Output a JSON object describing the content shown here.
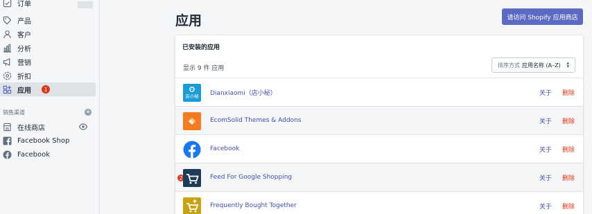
{
  "sidebar": {
    "items": [
      {
        "label": "订单",
        "icon": "orders-icon"
      },
      {
        "label": "产品",
        "icon": "tag-icon"
      },
      {
        "label": "客户",
        "icon": "person-icon"
      },
      {
        "label": "分析",
        "icon": "chart-icon"
      },
      {
        "label": "营销",
        "icon": "megaphone-icon"
      },
      {
        "label": "折扣",
        "icon": "gear-discount-icon"
      },
      {
        "label": "应用",
        "icon": "apps-icon",
        "badge": "1",
        "active": true
      }
    ],
    "channels_heading": "销售渠道",
    "channels": [
      {
        "label": "在线商店",
        "icon": "store-icon"
      },
      {
        "label": "Facebook Shop",
        "icon": "facebook-square-icon"
      },
      {
        "label": "Facebook",
        "icon": "facebook-circle-icon"
      }
    ]
  },
  "main": {
    "title": "应用",
    "shop_button": "请访问 Shopify 应用商店",
    "card_heading": "已安装的应用",
    "count_text": "显示 9 件 应用",
    "sort_label": "排序方式",
    "sort_value": "应用名称 (A–Z)",
    "about_label": "关于",
    "delete_label": "删除",
    "apps": [
      {
        "name": "Dianxiaomi（店小秘）",
        "icon": "dianxiaomi-icon"
      },
      {
        "name": "EcomSolid Themes & Addons",
        "icon": "ecomsolid-icon"
      },
      {
        "name": "Facebook",
        "icon": "facebook-icon"
      },
      {
        "name": "Feed For Google Shopping",
        "icon": "cart-icon",
        "badge": "2"
      },
      {
        "name": "Frequently Bought Together",
        "icon": "cart-plus-icon"
      }
    ]
  },
  "colors": {
    "accent": "#5c6ac4",
    "link": "#3f4eae",
    "danger": "#de3618"
  }
}
